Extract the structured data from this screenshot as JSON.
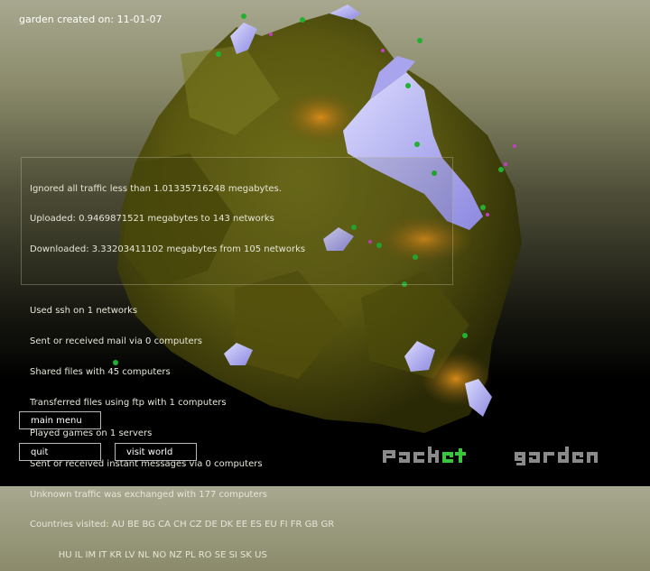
{
  "header": {
    "created_label": "garden created on:",
    "created_date": "11-01-07"
  },
  "stats": {
    "lines": [
      "Ignored all traffic less than 1.01335716248 megabytes.",
      "Uploaded: 0.9469871521 megabytes to 143 networks",
      "Downloaded: 3.33203411102 megabytes from 105 networks",
      "",
      "Used ssh on 1 networks",
      "Sent or received mail via 0 computers",
      "Shared files with 45 computers",
      "Transferred files using ftp with 1 computers",
      "Played games on 1 servers",
      "Sent or received instant messages via 0 computers",
      "Unknown traffic was exchanged with 177 computers",
      "Countries visited: AU BE BG CA CH CZ DE DK EE ES EU FI FR GB GR",
      "          HU IL IM IT KR LV NL NO NZ PL RO SE SI SK US"
    ]
  },
  "buttons": {
    "main_menu": "main menu",
    "quit": "quit",
    "visit_world": "visit world"
  },
  "logo": {
    "text": "packet garden"
  },
  "colors": {
    "terrain": "#6b6a18",
    "snow": "#b4b0f2",
    "glow": "#c07a14",
    "plant": "#22b030"
  }
}
